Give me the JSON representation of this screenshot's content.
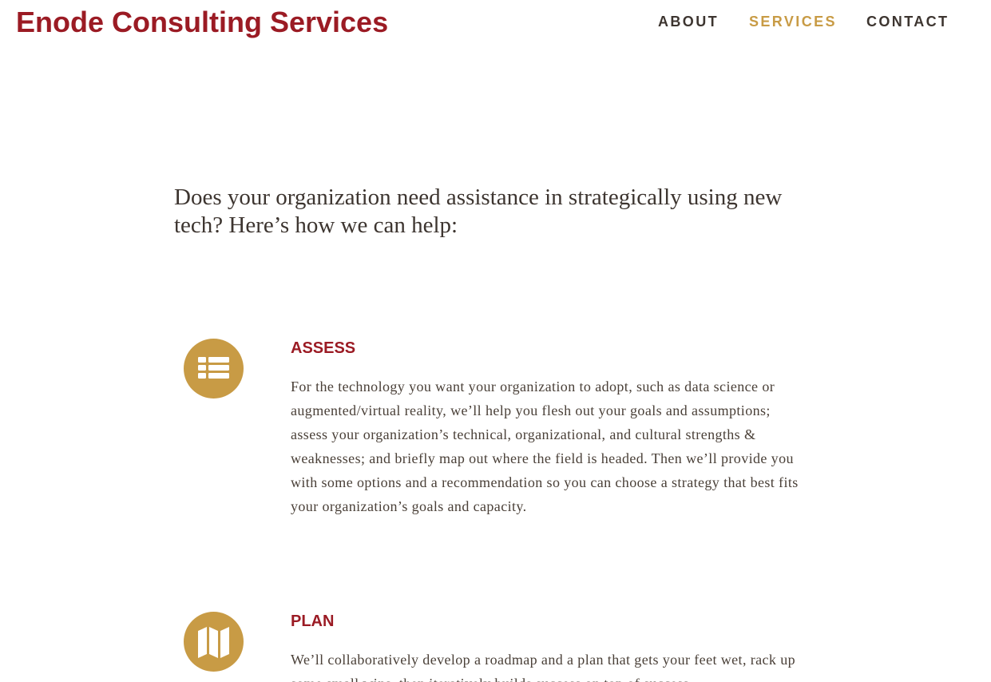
{
  "header": {
    "site_title": "Enode Consulting Services",
    "nav": {
      "about": "ABOUT",
      "services": "SERVICES",
      "contact": "CONTACT"
    }
  },
  "main": {
    "intro": "Does your organization need assistance in strategically using new tech? Here’s how we can help:",
    "services": [
      {
        "icon": "list-icon",
        "heading": "ASSESS",
        "text": "For the technology you want your organization to adopt, such as data science or augmented/virtual reality, we’ll help you flesh out your goals and assumptions; assess your organization’s technical, organizational, and cultural strengths & weaknesses; and briefly map out where the field is headed.  Then we’ll provide you with some options and a recommendation so you can choose a strategy that best fits your organization’s goals and capacity."
      },
      {
        "icon": "map-icon",
        "heading": "PLAN",
        "text": "We’ll collaboratively develop a roadmap and a plan that gets your feet wet, rack up some small wins, then iteratively builds success on top of success."
      }
    ]
  },
  "colors": {
    "brand": "#9b1b24",
    "accent": "#c89b45",
    "text": "#4a4038"
  }
}
